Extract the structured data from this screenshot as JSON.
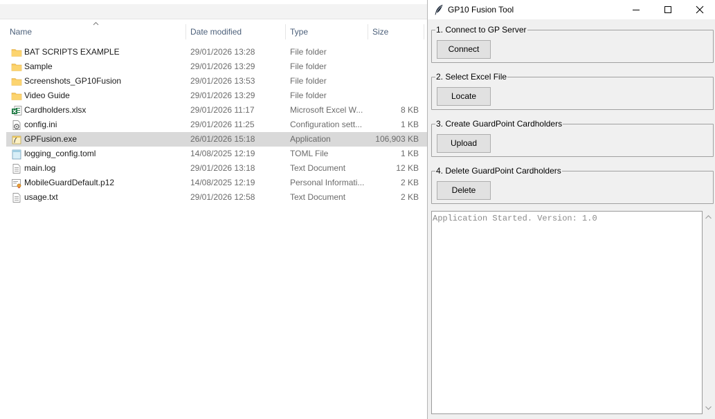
{
  "explorer": {
    "columns": {
      "name": "Name",
      "date": "Date modified",
      "type": "Type",
      "size": "Size"
    },
    "files": [
      {
        "name": "BAT SCRIPTS EXAMPLE",
        "date": "29/01/2026 13:28",
        "type": "File folder",
        "size": "",
        "icon": "folder-icon"
      },
      {
        "name": "Sample",
        "date": "29/01/2026 13:29",
        "type": "File folder",
        "size": "",
        "icon": "folder-icon"
      },
      {
        "name": "Screenshots_GP10Fusion",
        "date": "29/01/2026 13:53",
        "type": "File folder",
        "size": "",
        "icon": "folder-icon"
      },
      {
        "name": "Video Guide",
        "date": "29/01/2026 13:29",
        "type": "File folder",
        "size": "",
        "icon": "folder-icon"
      },
      {
        "name": "Cardholders.xlsx",
        "date": "29/01/2026 11:17",
        "type": "Microsoft Excel W...",
        "size": "8 KB",
        "icon": "excel-file-icon"
      },
      {
        "name": "config.ini",
        "date": "29/01/2026 11:25",
        "type": "Configuration sett...",
        "size": "1 KB",
        "icon": "config-file-icon"
      },
      {
        "name": "GPFusion.exe",
        "date": "26/01/2026 15:18",
        "type": "Application",
        "size": "106,903 KB",
        "icon": "exe-file-icon",
        "selected": true
      },
      {
        "name": "logging_config.toml",
        "date": "14/08/2025 12:19",
        "type": "TOML File",
        "size": "1 KB",
        "icon": "toml-file-icon"
      },
      {
        "name": "main.log",
        "date": "29/01/2026 13:18",
        "type": "Text Document",
        "size": "12 KB",
        "icon": "text-file-icon"
      },
      {
        "name": "MobileGuardDefault.p12",
        "date": "14/08/2025 12:19",
        "type": "Personal Informati...",
        "size": "2 KB",
        "icon": "certificate-file-icon"
      },
      {
        "name": "usage.txt",
        "date": "29/01/2026 12:58",
        "type": "Text Document",
        "size": "2 KB",
        "icon": "text-file-icon"
      }
    ]
  },
  "app": {
    "title": "GP10 Fusion Tool",
    "sections": [
      {
        "legend": "1. Connect to GP Server",
        "button": "Connect"
      },
      {
        "legend": "2. Select Excel File",
        "button": "Locate"
      },
      {
        "legend": "3. Create GuardPoint Cardholders",
        "button": "Upload"
      },
      {
        "legend": "4. Delete GuardPoint Cardholders",
        "button": "Delete"
      }
    ],
    "log": "Application Started. Version: 1.0"
  },
  "colors": {
    "selected_row": "#d9d9d9",
    "header_text": "#4c607a",
    "folder": "#f8c65a",
    "button_face": "#e1e1e1",
    "window_bg": "#f0f0f0"
  }
}
